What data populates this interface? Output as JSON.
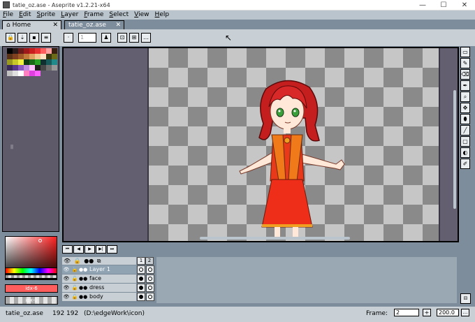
{
  "window": {
    "title": "tatie_oz.ase - Aseprite v1.2.21-x64",
    "minimize": "—",
    "maximize": "☐",
    "close": "✕"
  },
  "menu": [
    "File",
    "Edit",
    "Sprite",
    "Layer",
    "Frame",
    "Select",
    "View",
    "Help"
  ],
  "tabs": [
    {
      "label": "Home",
      "close": "✕"
    },
    {
      "label": "tatie_oz.ase",
      "close": "✕"
    }
  ],
  "toolbar": {
    "opacity_value": "1"
  },
  "palette": {
    "colors": [
      "#000000",
      "#2a1a1a",
      "#6b1a1a",
      "#9e1a1a",
      "#c81e1e",
      "#e63232",
      "#ff5e5e",
      "#ffa0a0",
      "#3a2010",
      "#5a3218",
      "#804020",
      "#a05a28",
      "#c07a3a",
      "#e0a060",
      "#f0c890",
      "#ffe0c0",
      "#3a3a10",
      "#6a6a18",
      "#9a9a20",
      "#c8c828",
      "#f0f040",
      "#103a10",
      "#186a18",
      "#28a028",
      "#103030",
      "#185a5a",
      "#208a8a",
      "#3a2a5a",
      "#5a3a8a",
      "#8a5ac0",
      "#c08ae0",
      "#ffc0ff",
      "#202020",
      "#484848",
      "#707070",
      "#989898",
      "#c0c0c0",
      "#e0e0e0",
      "#ffffff",
      "#ff80c0",
      "#e040e0",
      "#ff60ff"
    ],
    "fg_label": "idx-6",
    "bg_label": "idx-0",
    "fg_color": "#ff5e5e"
  },
  "tools": [
    "▭",
    "✎",
    "⌫",
    "✒",
    "⌕",
    "✥",
    "⬮",
    "╱",
    "▢",
    "◐",
    "✐"
  ],
  "timeline": {
    "controls": [
      "⏮",
      "◀",
      "▶",
      "▶|",
      "⏭"
    ],
    "frames": [
      "1",
      "2"
    ],
    "layers": [
      {
        "name": "Layer 1",
        "active": true,
        "cels": [
          "empty",
          "empty"
        ]
      },
      {
        "name": "face",
        "active": false,
        "cels": [
          "full",
          "empty"
        ]
      },
      {
        "name": "dress",
        "active": false,
        "cels": [
          "full",
          "empty"
        ]
      },
      {
        "name": "body",
        "active": false,
        "cels": [
          "full",
          "empty"
        ]
      }
    ]
  },
  "status": {
    "file": "tatie_oz.ase",
    "position": "192 192",
    "path": "(D:\\edgeWork\\icon)",
    "frame_label": "Frame:",
    "frame_value": "2",
    "plus": "+",
    "zoom": "200.0",
    "more": "..."
  }
}
